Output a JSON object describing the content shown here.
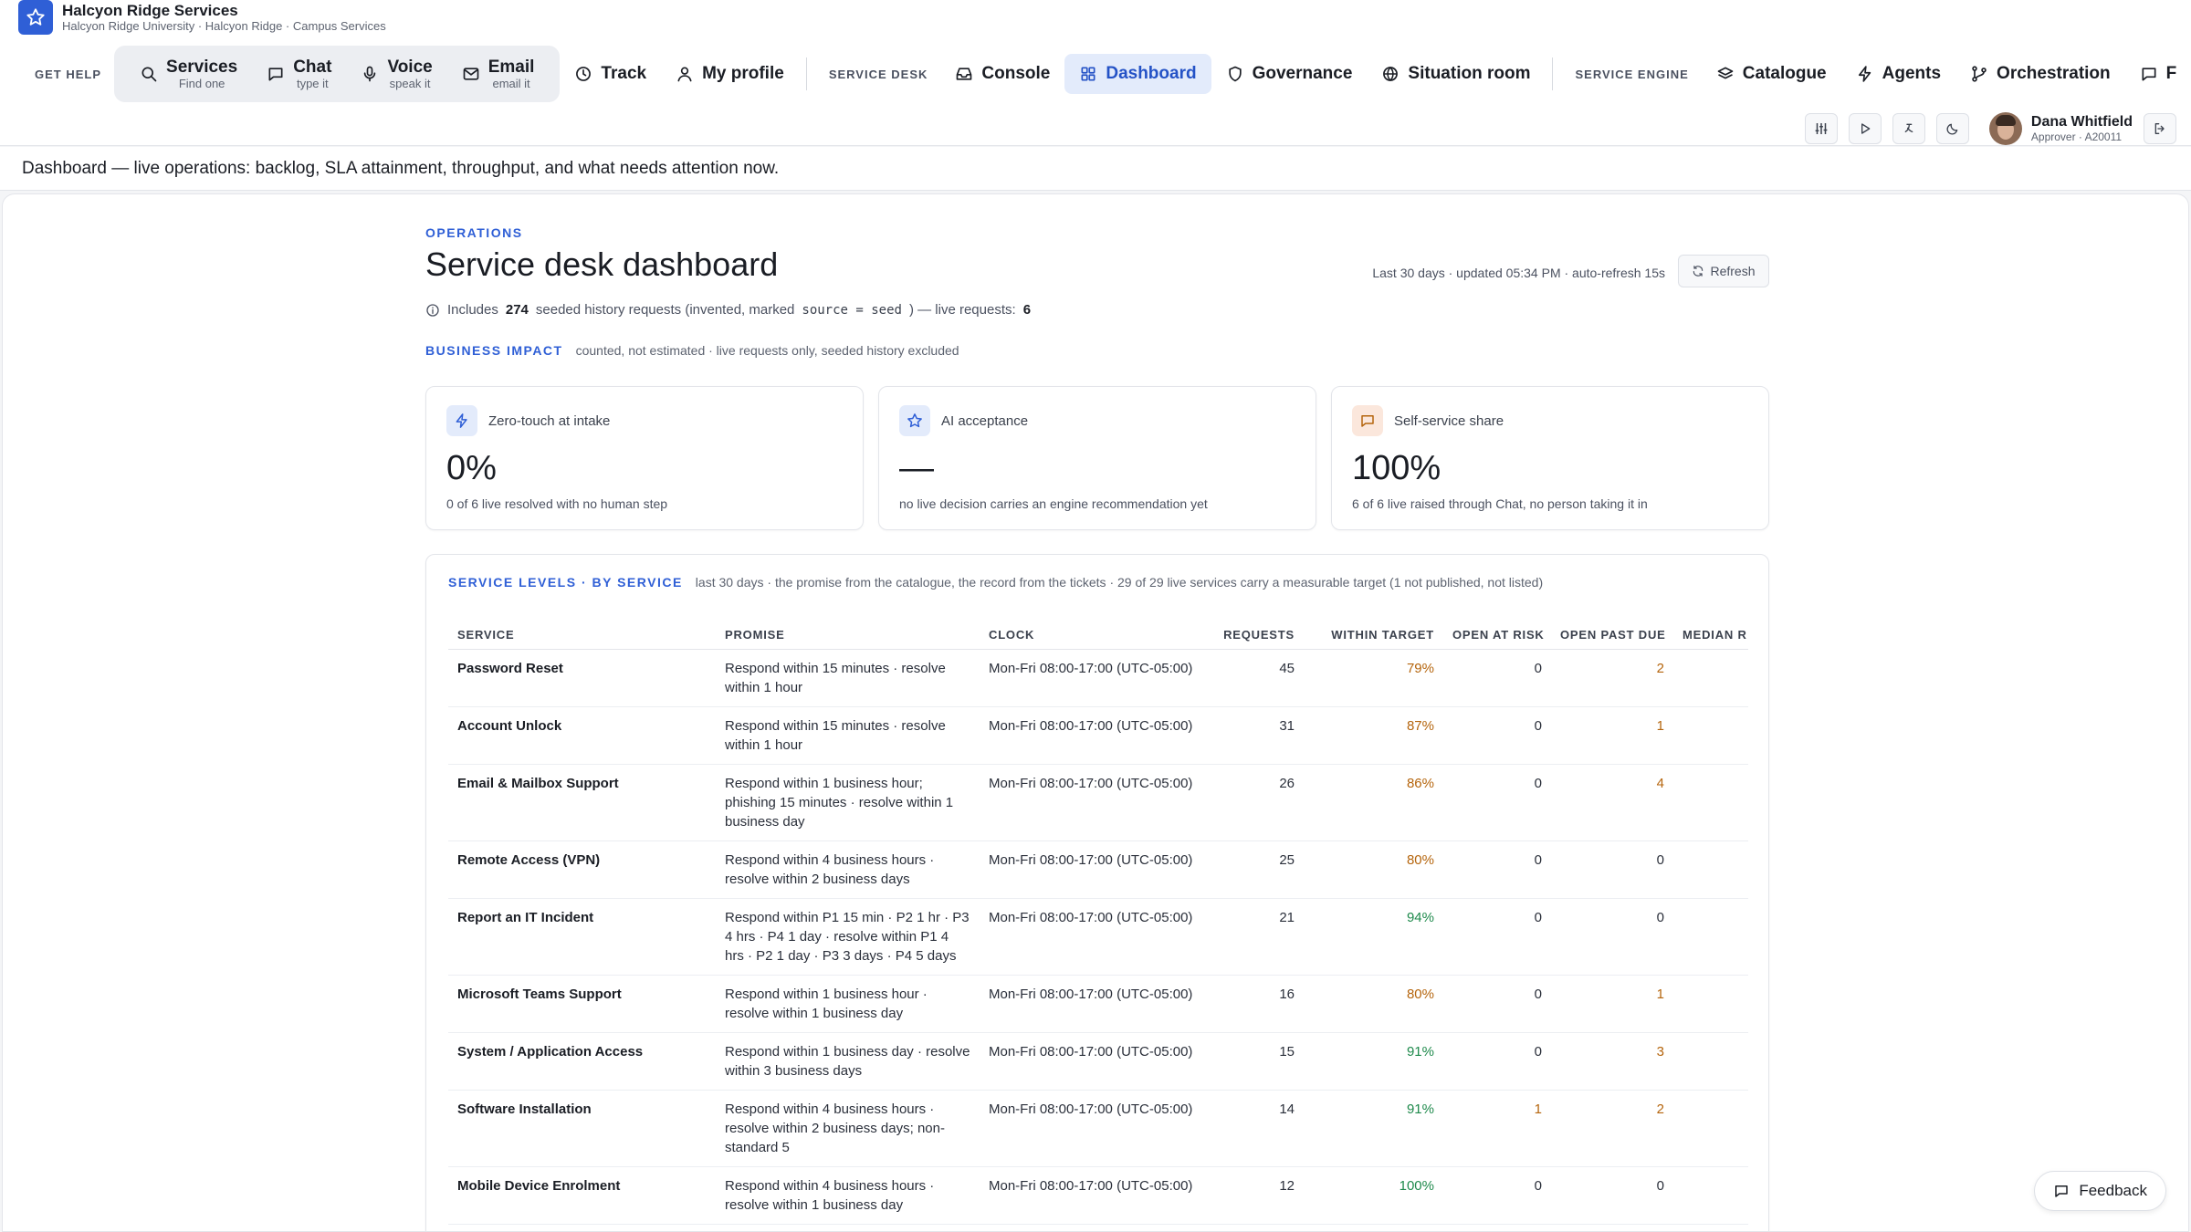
{
  "brand": {
    "title": "Halcyon Ridge Services",
    "subtitle": "Halcyon Ridge University · Halcyon Ridge · Campus Services"
  },
  "nav": {
    "get_help_label": "GET HELP",
    "services": {
      "label": "Services",
      "sub": "Find one"
    },
    "chat": {
      "label": "Chat",
      "sub": "type it"
    },
    "voice": {
      "label": "Voice",
      "sub": "speak it"
    },
    "email": {
      "label": "Email",
      "sub": "email it"
    },
    "track": "Track",
    "my_profile": "My profile",
    "service_desk_label": "SERVICE DESK",
    "console": "Console",
    "dashboard": "Dashboard",
    "governance": "Governance",
    "situation_room": "Situation room",
    "service_engine_label": "SERVICE ENGINE",
    "catalogue": "Catalogue",
    "agents": "Agents",
    "orchestration": "Orchestration",
    "overflow": "F"
  },
  "user": {
    "name": "Dana Whitfield",
    "role": "Approver · A20011"
  },
  "banner": "Dashboard — live operations: backlog, SLA attainment, throughput, and what needs attention now.",
  "page": {
    "eyebrow": "OPERATIONS",
    "title": "Service desk dashboard",
    "meta": "Last 30 days · updated 05:34 PM · auto-refresh 15s",
    "refresh": "Refresh",
    "info": {
      "prefix": "Includes",
      "count": "274",
      "mid": "seeded history requests (invented, marked",
      "code": "source = seed",
      "suffix": ") — live requests:",
      "live": "6"
    }
  },
  "impact": {
    "title": "BUSINESS IMPACT",
    "note": "counted, not estimated · live requests only, seeded history excluded",
    "kpis": [
      {
        "label": "Zero-touch at intake",
        "value": "0%",
        "note": "0 of 6 live resolved with no human step",
        "icon": "lightning-icon"
      },
      {
        "label": "AI acceptance",
        "value": "—",
        "note": "no live decision carries an engine recommendation yet",
        "icon": "star-icon"
      },
      {
        "label": "Self-service share",
        "value": "100%",
        "note": "6 of 6 live raised through Chat, no person taking it in",
        "icon": "chat-bubble-icon"
      }
    ]
  },
  "service_levels": {
    "title": "SERVICE LEVELS · BY SERVICE",
    "note": "last 30 days · the promise from the catalogue, the record from the tickets · 29 of 29 live services carry a measurable target (1 not published, not listed)",
    "columns": [
      "SERVICE",
      "PROMISE",
      "CLOCK",
      "REQUESTS",
      "WITHIN TARGET",
      "OPEN AT RISK",
      "OPEN PAST DUE",
      "MEDIAN R"
    ],
    "rows": [
      {
        "service": "Password Reset",
        "promise": "Respond within 15 minutes · resolve within 1 hour",
        "clock": "Mon-Fri 08:00-17:00 (UTC-05:00)",
        "requests": "45",
        "within": "79%",
        "within_tone": "amber",
        "at_risk": "0",
        "at_risk_tone": "",
        "past_due": "2",
        "past_due_tone": "amber",
        "median": ""
      },
      {
        "service": "Account Unlock",
        "promise": "Respond within 15 minutes · resolve within 1 hour",
        "clock": "Mon-Fri 08:00-17:00 (UTC-05:00)",
        "requests": "31",
        "within": "87%",
        "within_tone": "amber",
        "at_risk": "0",
        "at_risk_tone": "",
        "past_due": "1",
        "past_due_tone": "amber",
        "median": ""
      },
      {
        "service": "Email & Mailbox Support",
        "promise": "Respond within 1 business hour; phishing 15 minutes · resolve within 1 business day",
        "clock": "Mon-Fri 08:00-17:00 (UTC-05:00)",
        "requests": "26",
        "within": "86%",
        "within_tone": "amber",
        "at_risk": "0",
        "at_risk_tone": "",
        "past_due": "4",
        "past_due_tone": "amber",
        "median": ""
      },
      {
        "service": "Remote Access (VPN)",
        "promise": "Respond within 4 business hours · resolve within 2 business days",
        "clock": "Mon-Fri 08:00-17:00 (UTC-05:00)",
        "requests": "25",
        "within": "80%",
        "within_tone": "amber",
        "at_risk": "0",
        "at_risk_tone": "",
        "past_due": "0",
        "past_due_tone": "",
        "median": ""
      },
      {
        "service": "Report an IT Incident",
        "promise": "Respond within P1 15 min · P2 1 hr · P3 4 hrs · P4 1 day · resolve within P1 4 hrs · P2 1 day · P3 3 days · P4 5 days",
        "clock": "Mon-Fri 08:00-17:00 (UTC-05:00)",
        "requests": "21",
        "within": "94%",
        "within_tone": "green",
        "at_risk": "0",
        "at_risk_tone": "",
        "past_due": "0",
        "past_due_tone": "",
        "median": ""
      },
      {
        "service": "Microsoft Teams Support",
        "promise": "Respond within 1 business hour · resolve within 1 business day",
        "clock": "Mon-Fri 08:00-17:00 (UTC-05:00)",
        "requests": "16",
        "within": "80%",
        "within_tone": "amber",
        "at_risk": "0",
        "at_risk_tone": "",
        "past_due": "1",
        "past_due_tone": "amber",
        "median": ""
      },
      {
        "service": "System / Application Access",
        "promise": "Respond within 1 business day · resolve within 3 business days",
        "clock": "Mon-Fri 08:00-17:00 (UTC-05:00)",
        "requests": "15",
        "within": "91%",
        "within_tone": "green",
        "at_risk": "0",
        "at_risk_tone": "",
        "past_due": "3",
        "past_due_tone": "amber",
        "median": "·"
      },
      {
        "service": "Software Installation",
        "promise": "Respond within 4 business hours · resolve within 2 business days; non-standard 5",
        "clock": "Mon-Fri 08:00-17:00 (UTC-05:00)",
        "requests": "14",
        "within": "91%",
        "within_tone": "green",
        "at_risk": "1",
        "at_risk_tone": "amber",
        "past_due": "2",
        "past_due_tone": "amber",
        "median": ""
      },
      {
        "service": "Mobile Device Enrolment",
        "promise": "Respond within 4 business hours · resolve within 1 business day",
        "clock": "Mon-Fri 08:00-17:00 (UTC-05:00)",
        "requests": "12",
        "within": "100%",
        "within_tone": "green",
        "at_risk": "0",
        "at_risk_tone": "",
        "past_due": "0",
        "past_due_tone": "",
        "median": ""
      }
    ]
  },
  "feedback": "Feedback",
  "colors": {
    "accent": "#2f5fd6",
    "amber": "#b5650d",
    "green": "#1f8a4c"
  }
}
